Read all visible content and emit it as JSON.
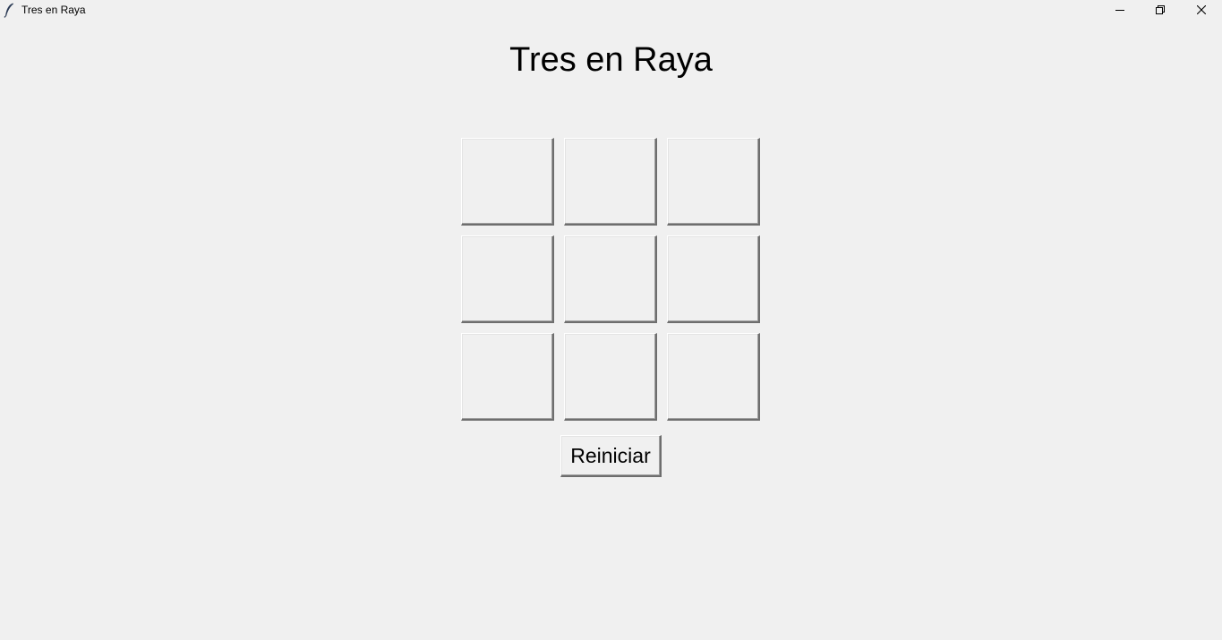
{
  "window": {
    "title": "Tres en Raya",
    "icon": "feather-icon",
    "controls": [
      "minimize-icon",
      "restore-icon",
      "close-icon"
    ]
  },
  "game": {
    "heading": "Tres en Raya",
    "board": [
      [
        "",
        "",
        ""
      ],
      [
        "",
        "",
        ""
      ],
      [
        "",
        "",
        ""
      ]
    ],
    "reset_label": "Reiniciar"
  }
}
